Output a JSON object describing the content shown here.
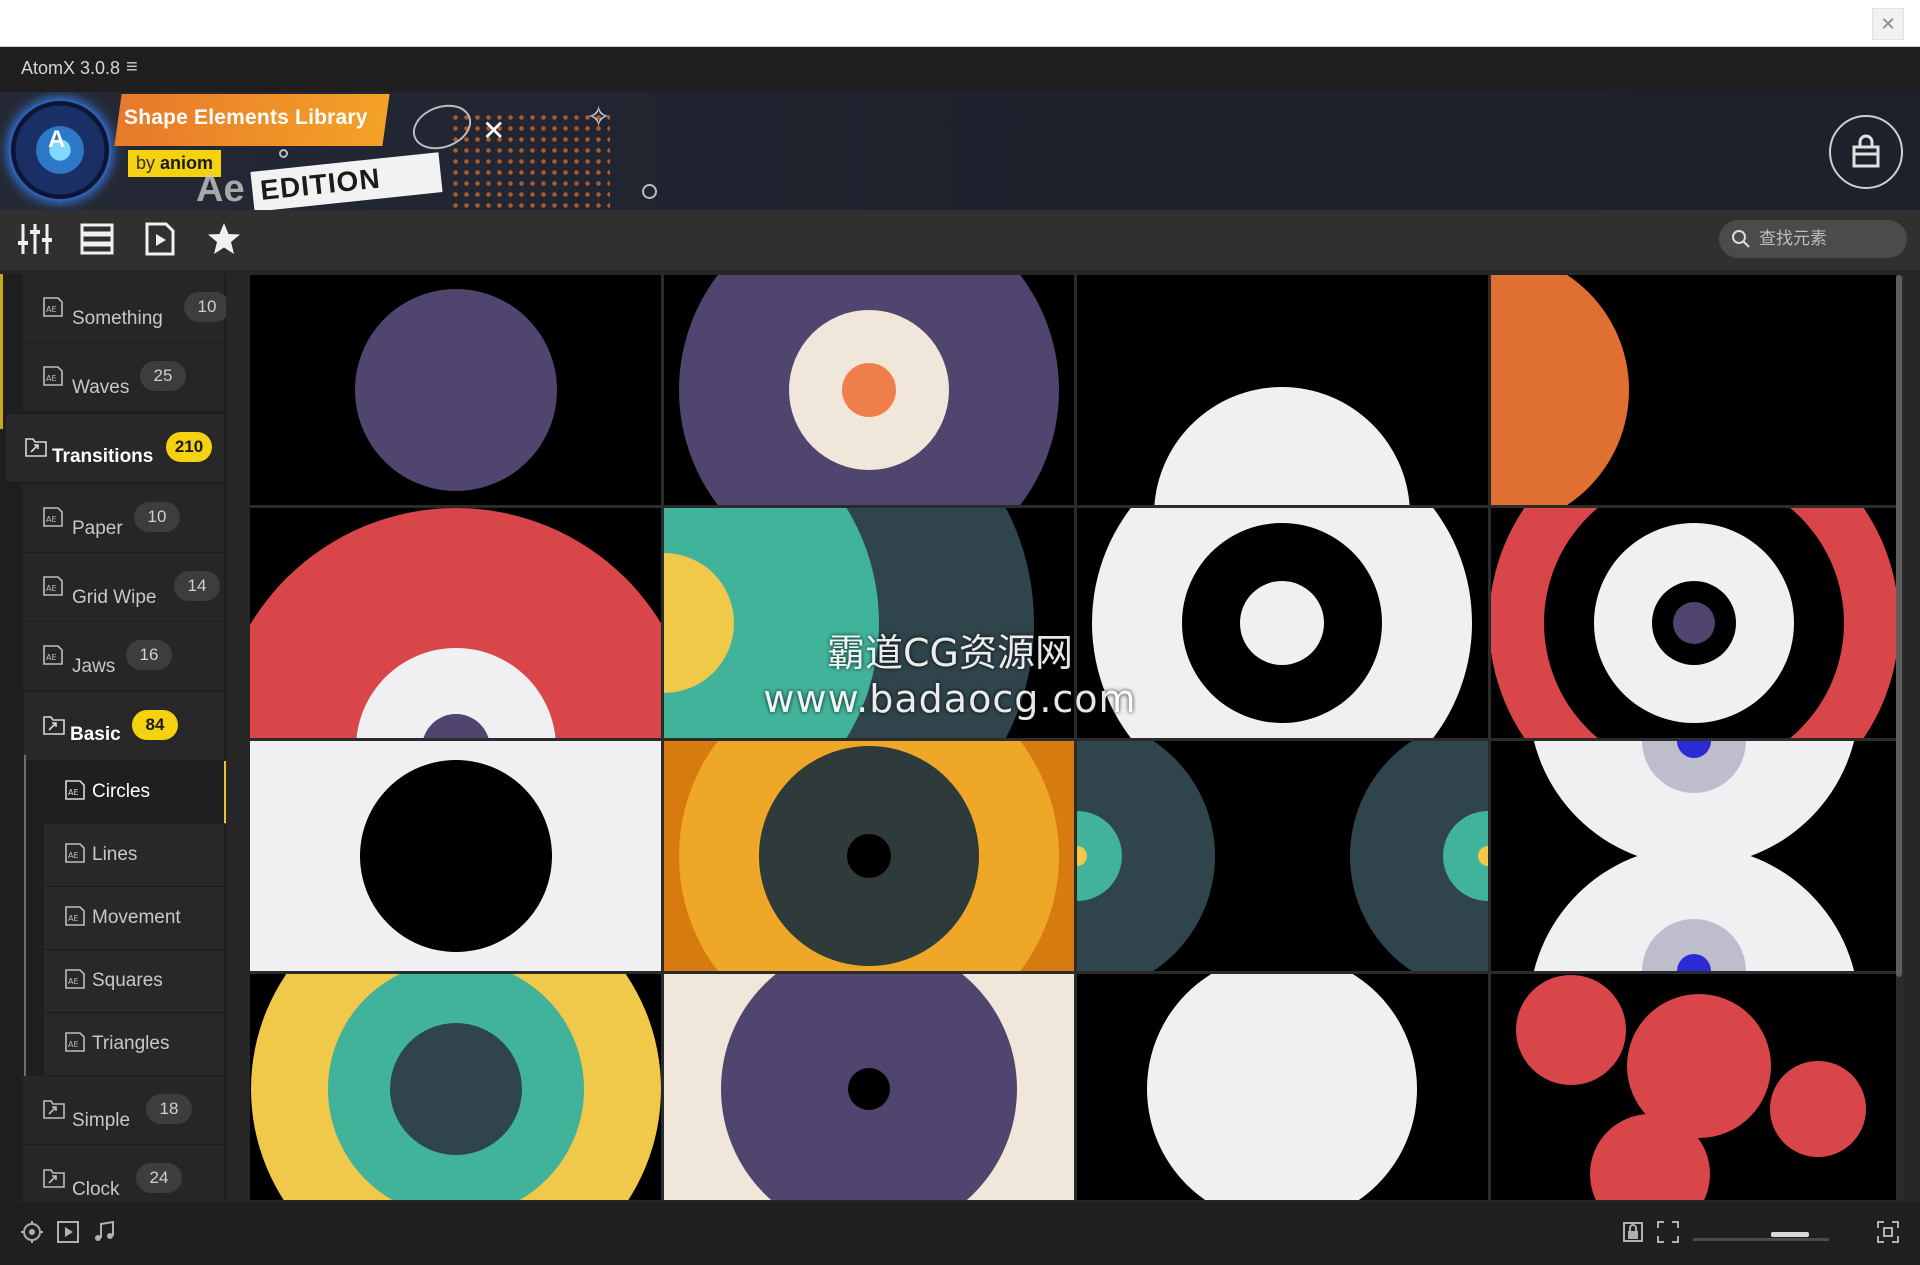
{
  "app": {
    "title": "AtomX 3.0.8",
    "menu_glyph": "≡",
    "window_close_glyph": "✕"
  },
  "banner": {
    "library_title": "Shape Elements Library",
    "by_prefix": "by",
    "by_name": "aniom",
    "ae_text": "Ae",
    "edition": "EDITION",
    "close_glyph": "✕",
    "sparkle_glyph": "✧"
  },
  "toolbar": {
    "search_placeholder": "查找元素",
    "icons": [
      "sliders-icon",
      "list-icon",
      "play-file-icon",
      "star-icon"
    ]
  },
  "sidebar": {
    "items": [
      {
        "label": "Something",
        "count": "10",
        "kind": "item"
      },
      {
        "label": "Waves",
        "count": "25",
        "kind": "item"
      },
      {
        "label": "Transitions",
        "count": "210",
        "kind": "category"
      },
      {
        "label": "Paper",
        "count": "10",
        "kind": "item"
      },
      {
        "label": "Grid Wipe",
        "count": "14",
        "kind": "item"
      },
      {
        "label": "Jaws",
        "count": "16",
        "kind": "item"
      },
      {
        "label": "Basic",
        "count": "84",
        "kind": "category"
      },
      {
        "label": "Circles",
        "kind": "sub",
        "selected": true
      },
      {
        "label": "Lines",
        "kind": "sub"
      },
      {
        "label": "Movement",
        "kind": "sub"
      },
      {
        "label": "Squares",
        "kind": "sub"
      },
      {
        "label": "Triangles",
        "kind": "sub"
      },
      {
        "label": "Simple",
        "count": "18",
        "kind": "item"
      },
      {
        "label": "Clock",
        "count": "24",
        "kind": "item"
      }
    ]
  },
  "watermark": {
    "line1": "霸道CG资源网",
    "line2": "www.badaocg.com"
  },
  "colors": {
    "purple": "#4f456e",
    "cream": "#f1e6da",
    "orange_dot": "#ef7e4a",
    "orange": "#e07032",
    "red": "#d9464a",
    "teal": "#42b39b",
    "dark_slate": "#2f444b",
    "yellow": "#f0c84a",
    "amber": "#eea726",
    "white": "#f0f0f2",
    "black": "#000000",
    "blue": "#2c2ad4",
    "lilac": "#bdbdcc",
    "accent_yellow": "#f5d20f"
  }
}
